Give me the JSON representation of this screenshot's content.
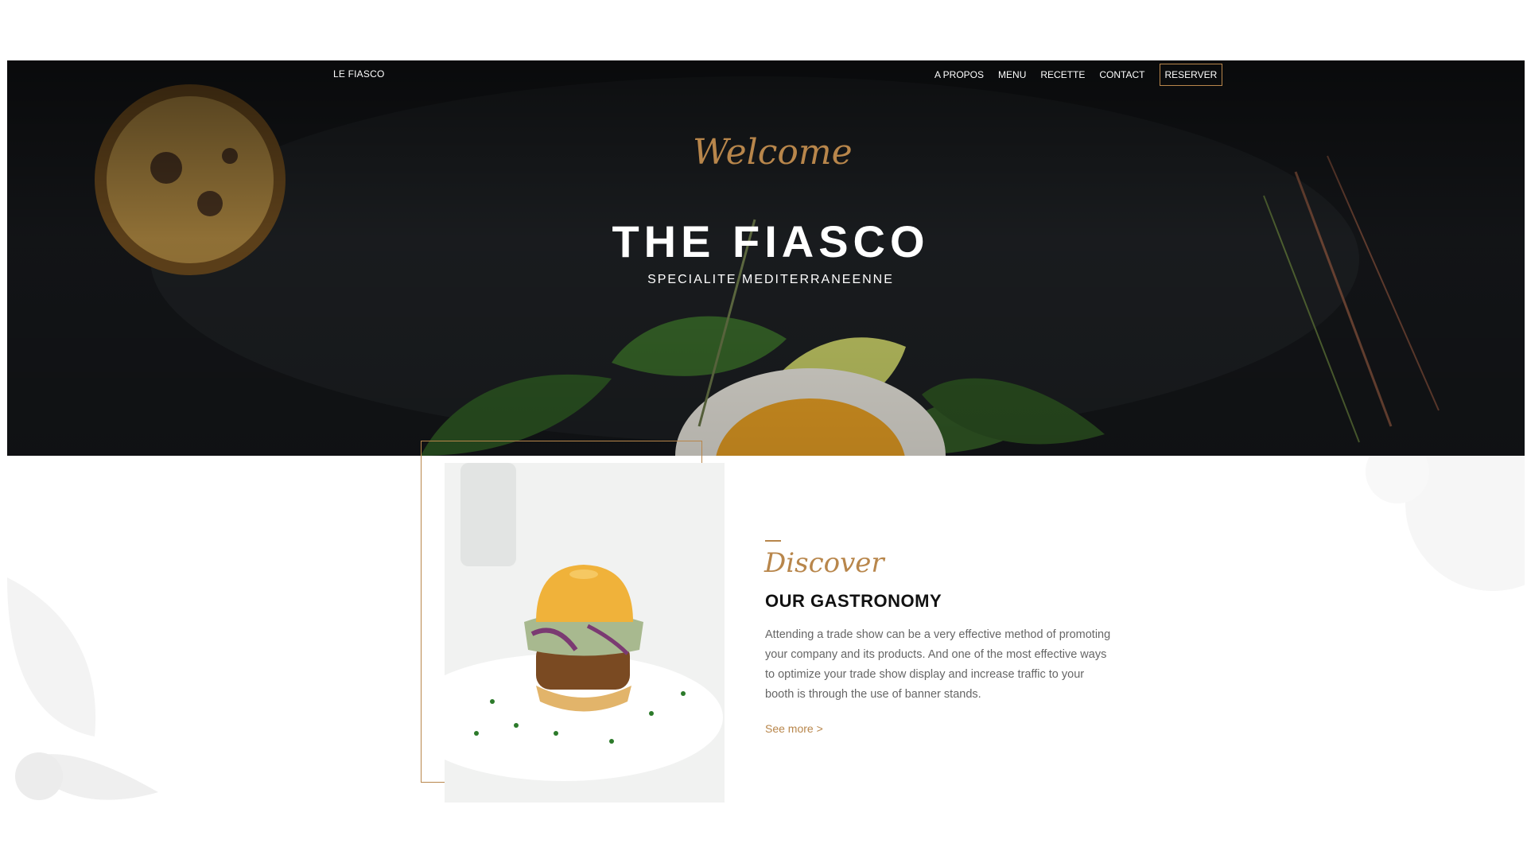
{
  "header": {
    "brand": "LE FIASCO",
    "nav": [
      "A PROPOS",
      "MENU",
      "RECETTE",
      "CONTACT"
    ],
    "cta": "RESERVER"
  },
  "hero": {
    "welcome": "Welcome",
    "title": "THE FIASCO",
    "subtitle": "SPECIALITE MEDITERRANEENNE"
  },
  "about": {
    "kicker": "Discover",
    "title": "OUR GASTRONOMY",
    "body": "Attending a trade show can be a very effective method of promoting your company and its products. And one of the most effective ways to optimize your trade show display and increase traffic to your booth is through the use of banner stands.",
    "link": "See more >"
  },
  "colors": {
    "accent": "#b8864b",
    "text_dark": "#111111",
    "text_body": "#666666"
  }
}
